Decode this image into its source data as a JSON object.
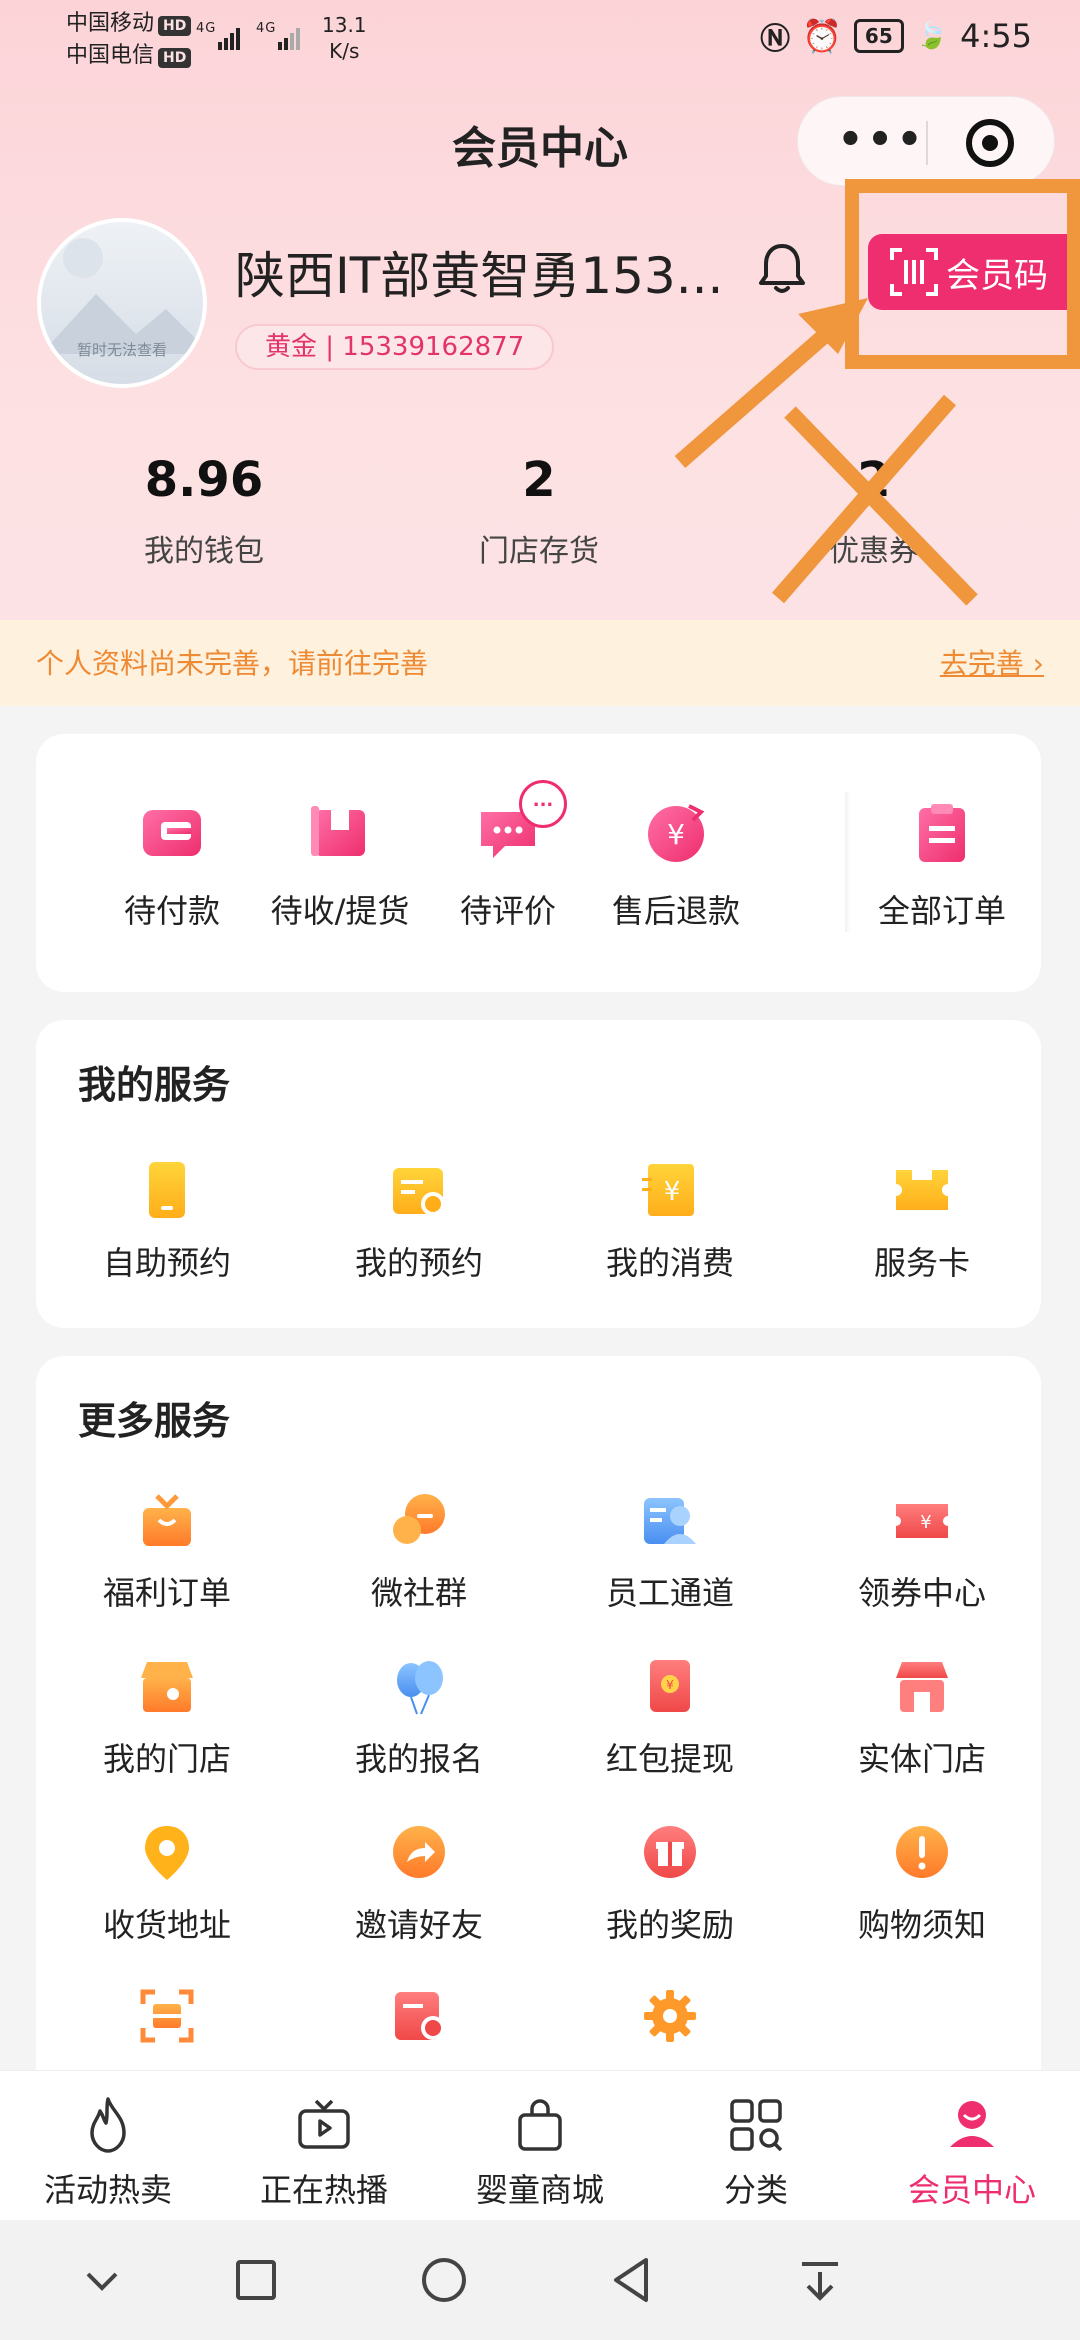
{
  "status": {
    "carrier1": "中国移动",
    "carrier2": "中国电信",
    "hd": "HD",
    "net": "4G",
    "speed_value": "13.1",
    "speed_unit": "K/s",
    "battery": "65",
    "time": "4:55"
  },
  "header": {
    "title": "会员中心",
    "more_label": "•••"
  },
  "profile": {
    "avatar_caption": "暂时无法查看",
    "name": "陕西IT部黄智勇153...",
    "level_phone": "黄金 | 15339162877",
    "member_code_label": "会员码"
  },
  "stats": [
    {
      "value": "8.96",
      "label": "我的钱包"
    },
    {
      "value": "2",
      "label": "门店存货"
    },
    {
      "value": "2",
      "label": "优惠券"
    }
  ],
  "notice": {
    "text": "个人资料尚未完善，请前往完善",
    "link": "去完善 ›"
  },
  "orders": [
    {
      "label": "待付款",
      "icon": "wallet-icon"
    },
    {
      "label": "待收/提货",
      "icon": "package-icon"
    },
    {
      "label": "待评价",
      "icon": "comment-icon",
      "badge": "..."
    },
    {
      "label": "售后退款",
      "icon": "refund-icon"
    },
    {
      "label": "全部订单",
      "icon": "clipboard-icon"
    }
  ],
  "my_services": {
    "title": "我的服务",
    "items": [
      {
        "label": "自助预约",
        "icon": "tablet-icon"
      },
      {
        "label": "我的预约",
        "icon": "appointment-icon"
      },
      {
        "label": "我的消费",
        "icon": "consumption-icon"
      },
      {
        "label": "服务卡",
        "icon": "ticket-icon"
      }
    ]
  },
  "more_services": {
    "title": "更多服务",
    "items": [
      {
        "label": "福利订单",
        "icon": "gift-box-icon"
      },
      {
        "label": "微社群",
        "icon": "chat-icon"
      },
      {
        "label": "员工通道",
        "icon": "staff-icon"
      },
      {
        "label": "领券中心",
        "icon": "coupon-icon"
      },
      {
        "label": "我的门店",
        "icon": "store-icon"
      },
      {
        "label": "我的报名",
        "icon": "balloon-icon"
      },
      {
        "label": "红包提现",
        "icon": "red-packet-icon"
      },
      {
        "label": "实体门店",
        "icon": "shop-icon"
      },
      {
        "label": "收货地址",
        "icon": "location-icon"
      },
      {
        "label": "邀请好友",
        "icon": "share-icon"
      },
      {
        "label": "我的奖励",
        "icon": "reward-icon"
      },
      {
        "label": "购物须知",
        "icon": "alert-icon"
      },
      {
        "label": "",
        "icon": "scan-icon"
      },
      {
        "label": "",
        "icon": "card-icon"
      },
      {
        "label": "",
        "icon": "gear-icon"
      }
    ]
  },
  "tabs": [
    {
      "label": "活动热卖",
      "icon": "fire-icon"
    },
    {
      "label": "正在热播",
      "icon": "tv-icon"
    },
    {
      "label": "婴童商城",
      "icon": "bag-icon"
    },
    {
      "label": "分类",
      "icon": "category-icon"
    },
    {
      "label": "会员中心",
      "icon": "member-icon",
      "active": true
    }
  ],
  "colors": {
    "accent": "#ee2e6e",
    "annotation": "#f0963c",
    "notice_text": "#ee8a34"
  }
}
